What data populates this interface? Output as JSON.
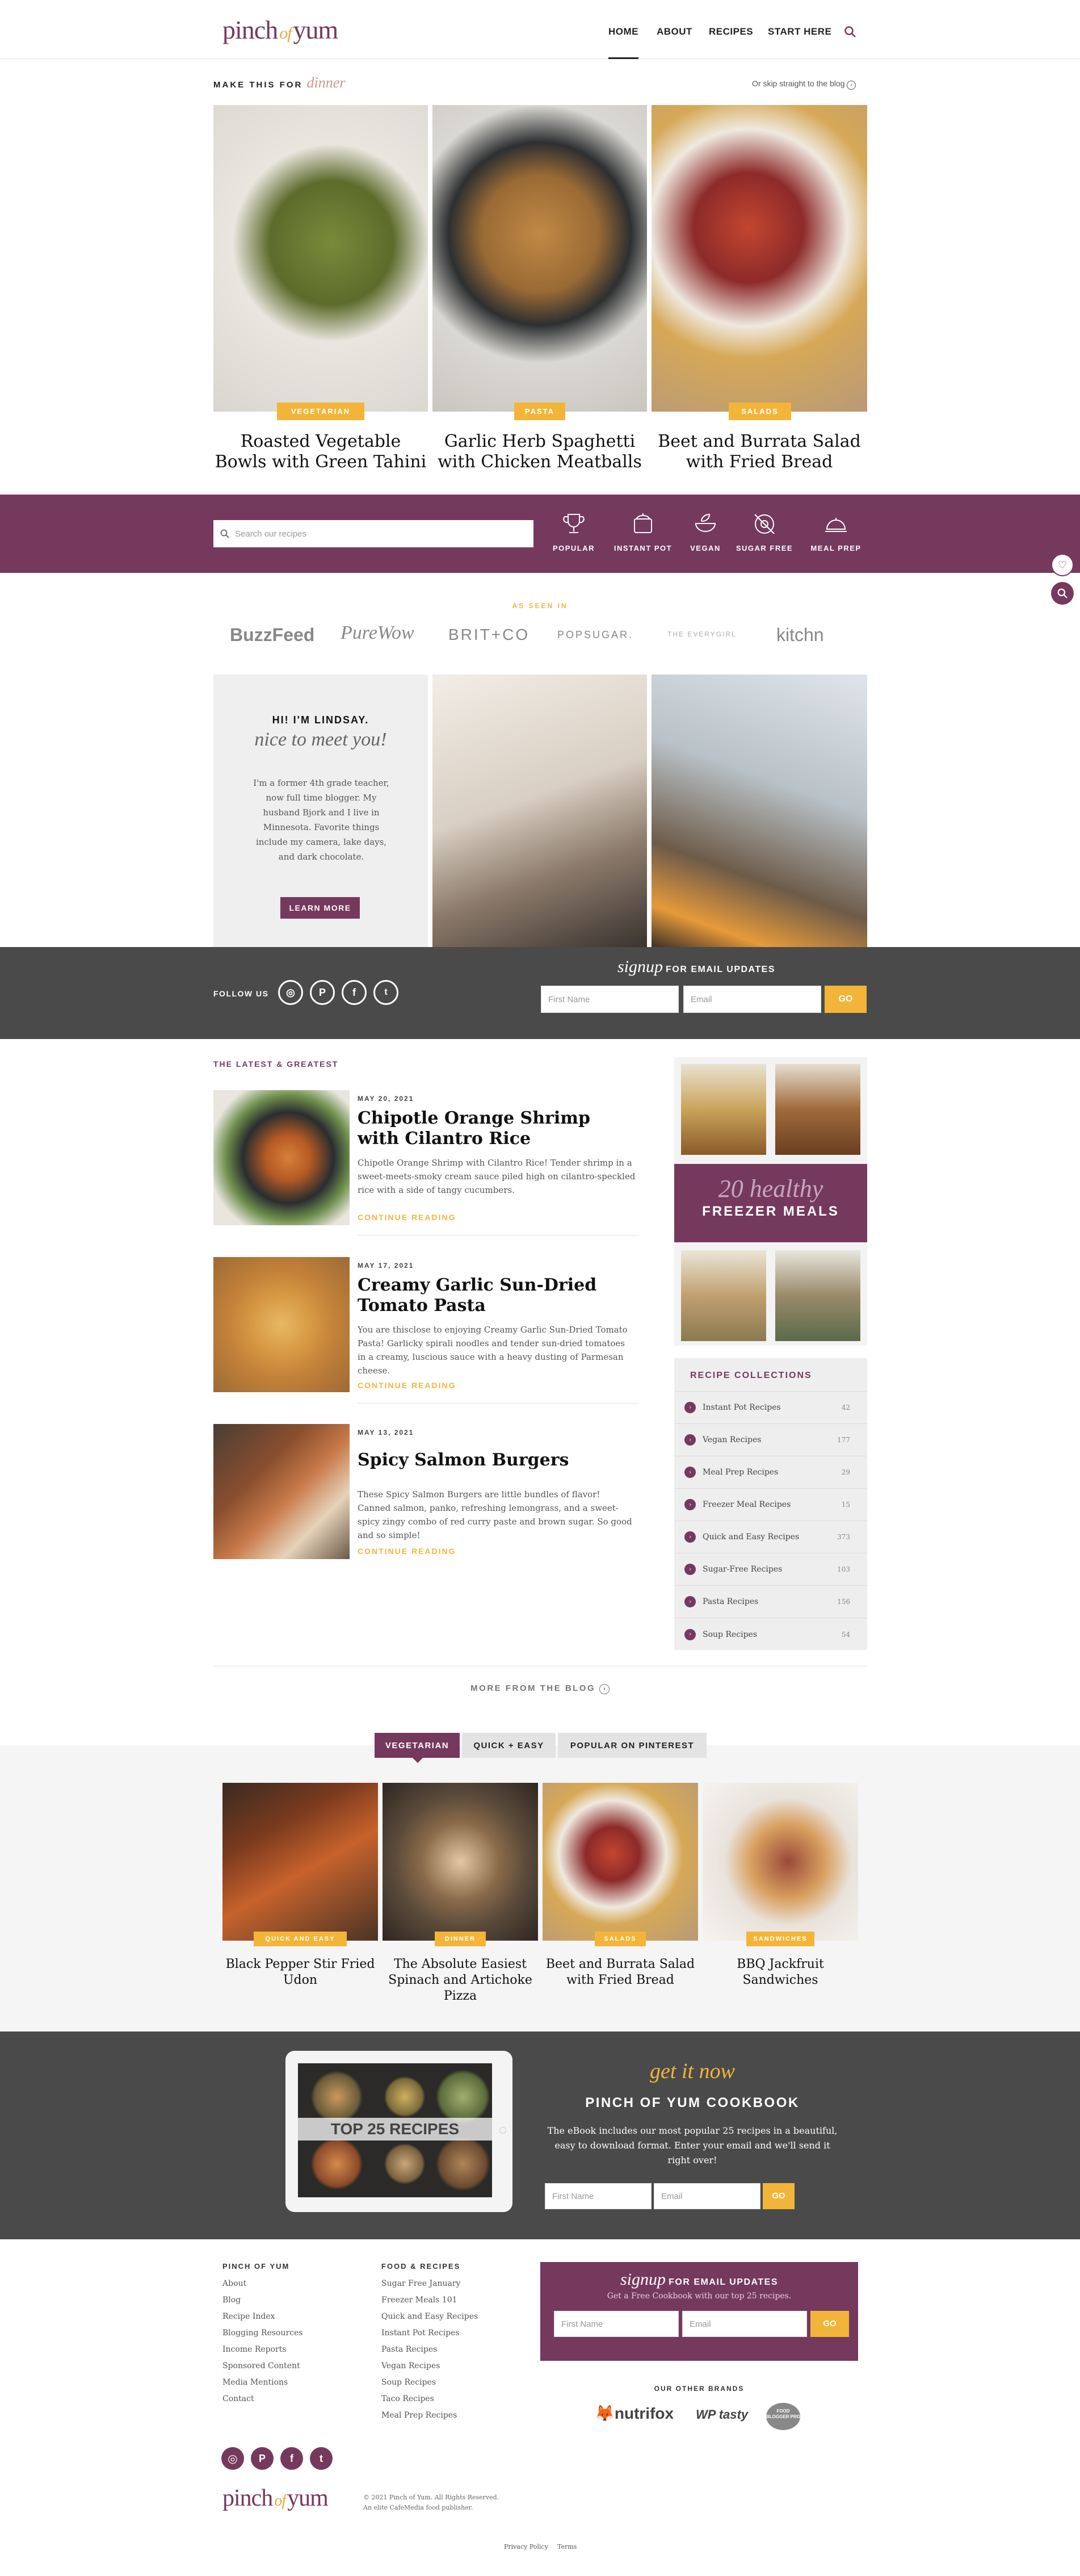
{
  "header": {
    "logo_part1": "pinch",
    "logo_of": "of",
    "logo_part2": "yum",
    "nav": [
      "HOME",
      "ABOUT",
      "RECIPES",
      "START HERE"
    ],
    "search_icon": "search-icon"
  },
  "hero": {
    "kicker": "MAKE THIS FOR",
    "kicker_script": "dinner",
    "skip_link": "Or skip straight to the blog",
    "tiles": [
      {
        "category": "VEGETARIAN",
        "title": "Roasted Vegetable Bowls with Green Tahini"
      },
      {
        "category": "PASTA",
        "title": "Garlic Herb Spaghetti with Chicken Meatballs"
      },
      {
        "category": "SALADS",
        "title": "Beet and Burrata Salad with Fried Bread"
      }
    ]
  },
  "searchbar": {
    "placeholder": "Search our recipes",
    "categories": [
      "POPULAR",
      "INSTANT POT",
      "VEGAN",
      "SUGAR FREE",
      "MEAL PREP"
    ]
  },
  "as_seen": {
    "label": "AS SEEN IN",
    "brands": [
      "BuzzFeed",
      "PureWow",
      "BRIT+CO",
      "POPSUGAR.",
      "THE EVERYGIRL",
      "kitchn"
    ]
  },
  "about": {
    "heading": "HI! I'M LINDSAY.",
    "script": "nice to meet you!",
    "text": "I'm a former 4th grade teacher, now full time blogger. My husband Bjork and I live in Minnesota. Favorite things include my camera, lake days, and dark chocolate.",
    "button": "LEARN MORE"
  },
  "followbar": {
    "follow_label": "FOLLOW US",
    "signup_script": "signup",
    "signup_label": "FOR EMAIL UPDATES",
    "first_name": "First Name",
    "email": "Email",
    "go": "GO"
  },
  "latest": {
    "heading": "THE LATEST & GREATEST",
    "posts": [
      {
        "date": "MAY 20, 2021",
        "title": "Chipotle Orange Shrimp with Cilantro Rice",
        "excerpt": "Chipotle Orange Shrimp with Cilantro Rice! Tender shrimp in a sweet-meets-smoky cream sauce piled high on cilantro-speckled rice with a side of tangy cucumbers.",
        "more": "CONTINUE READING"
      },
      {
        "date": "MAY 17, 2021",
        "title": "Creamy Garlic Sun-Dried Tomato Pasta",
        "excerpt": "You are thisclose to enjoying Creamy Garlic Sun-Dried Tomato Pasta! Garlicky spirali noodles and tender sun-dried tomatoes in a creamy, luscious sauce with a heavy dusting of Parmesan cheese.",
        "more": "CONTINUE READING"
      },
      {
        "date": "MAY 13, 2021",
        "title": "Spicy Salmon Burgers",
        "excerpt": "These Spicy Salmon Burgers are little bundles of flavor! Canned salmon, panko, refreshing lemongrass, and a sweet-spicy zingy combo of red curry paste and brown sugar. So good and so simple!",
        "more": "CONTINUE READING"
      }
    ],
    "more_link": "MORE FROM THE BLOG"
  },
  "sidebar": {
    "freezer_script": "20 healthy",
    "freezer_title": "FREEZER MEALS",
    "collections_heading": "RECIPE COLLECTIONS",
    "collections": [
      {
        "name": "Instant Pot Recipes",
        "count": "42"
      },
      {
        "name": "Vegan Recipes",
        "count": "177"
      },
      {
        "name": "Meal Prep Recipes",
        "count": "29"
      },
      {
        "name": "Freezer Meal Recipes",
        "count": "15"
      },
      {
        "name": "Quick and Easy Recipes",
        "count": "373"
      },
      {
        "name": "Sugar-Free Recipes",
        "count": "103"
      },
      {
        "name": "Pasta Recipes",
        "count": "156"
      },
      {
        "name": "Soup Recipes",
        "count": "54"
      }
    ]
  },
  "tabs": {
    "items": [
      "VEGETARIAN",
      "QUICK + EASY",
      "POPULAR ON PINTEREST"
    ],
    "cards": [
      {
        "category": "QUICK AND EASY",
        "title": "Black Pepper Stir Fried Udon"
      },
      {
        "category": "DINNER",
        "title": "The Absolute Easiest Spinach and Artichoke Pizza"
      },
      {
        "category": "SALADS",
        "title": "Beet and Burrata Salad with Fried Bread"
      },
      {
        "category": "SANDWICHES",
        "title": "BBQ Jackfruit Sandwiches"
      }
    ]
  },
  "cookbook": {
    "tablet_text": "TOP 25 RECIPES",
    "script": "get it now",
    "title": "PINCH OF YUM COOKBOOK",
    "text": "The eBook includes our most popular 25 recipes in a beautiful, easy to download format. Enter your email and we'll send it right over!",
    "first_name": "First Name",
    "email": "Email",
    "go": "GO"
  },
  "footer": {
    "col1_head": "PINCH OF YUM",
    "col1": [
      "About",
      "Blog",
      "Recipe Index",
      "Blogging Resources",
      "Income Reports",
      "Sponsored Content",
      "Media Mentions",
      "Contact"
    ],
    "col2_head": "FOOD & RECIPES",
    "col2": [
      "Sugar Free January",
      "Freezer Meals 101",
      "Quick and Easy Recipes",
      "Instant Pot Recipes",
      "Pasta Recipes",
      "Vegan Recipes",
      "Soup Recipes",
      "Taco Recipes",
      "Meal Prep Recipes"
    ],
    "signup_script": "signup",
    "signup_label": "FOR EMAIL UPDATES",
    "signup_sub": "Get a Free Cookbook with our top 25 recipes.",
    "first_name": "First Name",
    "email": "Email",
    "go": "GO",
    "other_brands": "OUR OTHER BRANDS",
    "brands": [
      "nutrifox",
      "WP tasty",
      "FOOD BLOGGER PRO"
    ],
    "copyright": "© 2021 Pinch of Yum. All Rights Reserved.",
    "publisher": "An elite CafeMedia food publisher.",
    "privacy": "Privacy Policy",
    "terms": "Terms"
  },
  "colors": {
    "purple": "#75395e",
    "gold": "#f2b53a",
    "dark": "#4a4a4a"
  }
}
